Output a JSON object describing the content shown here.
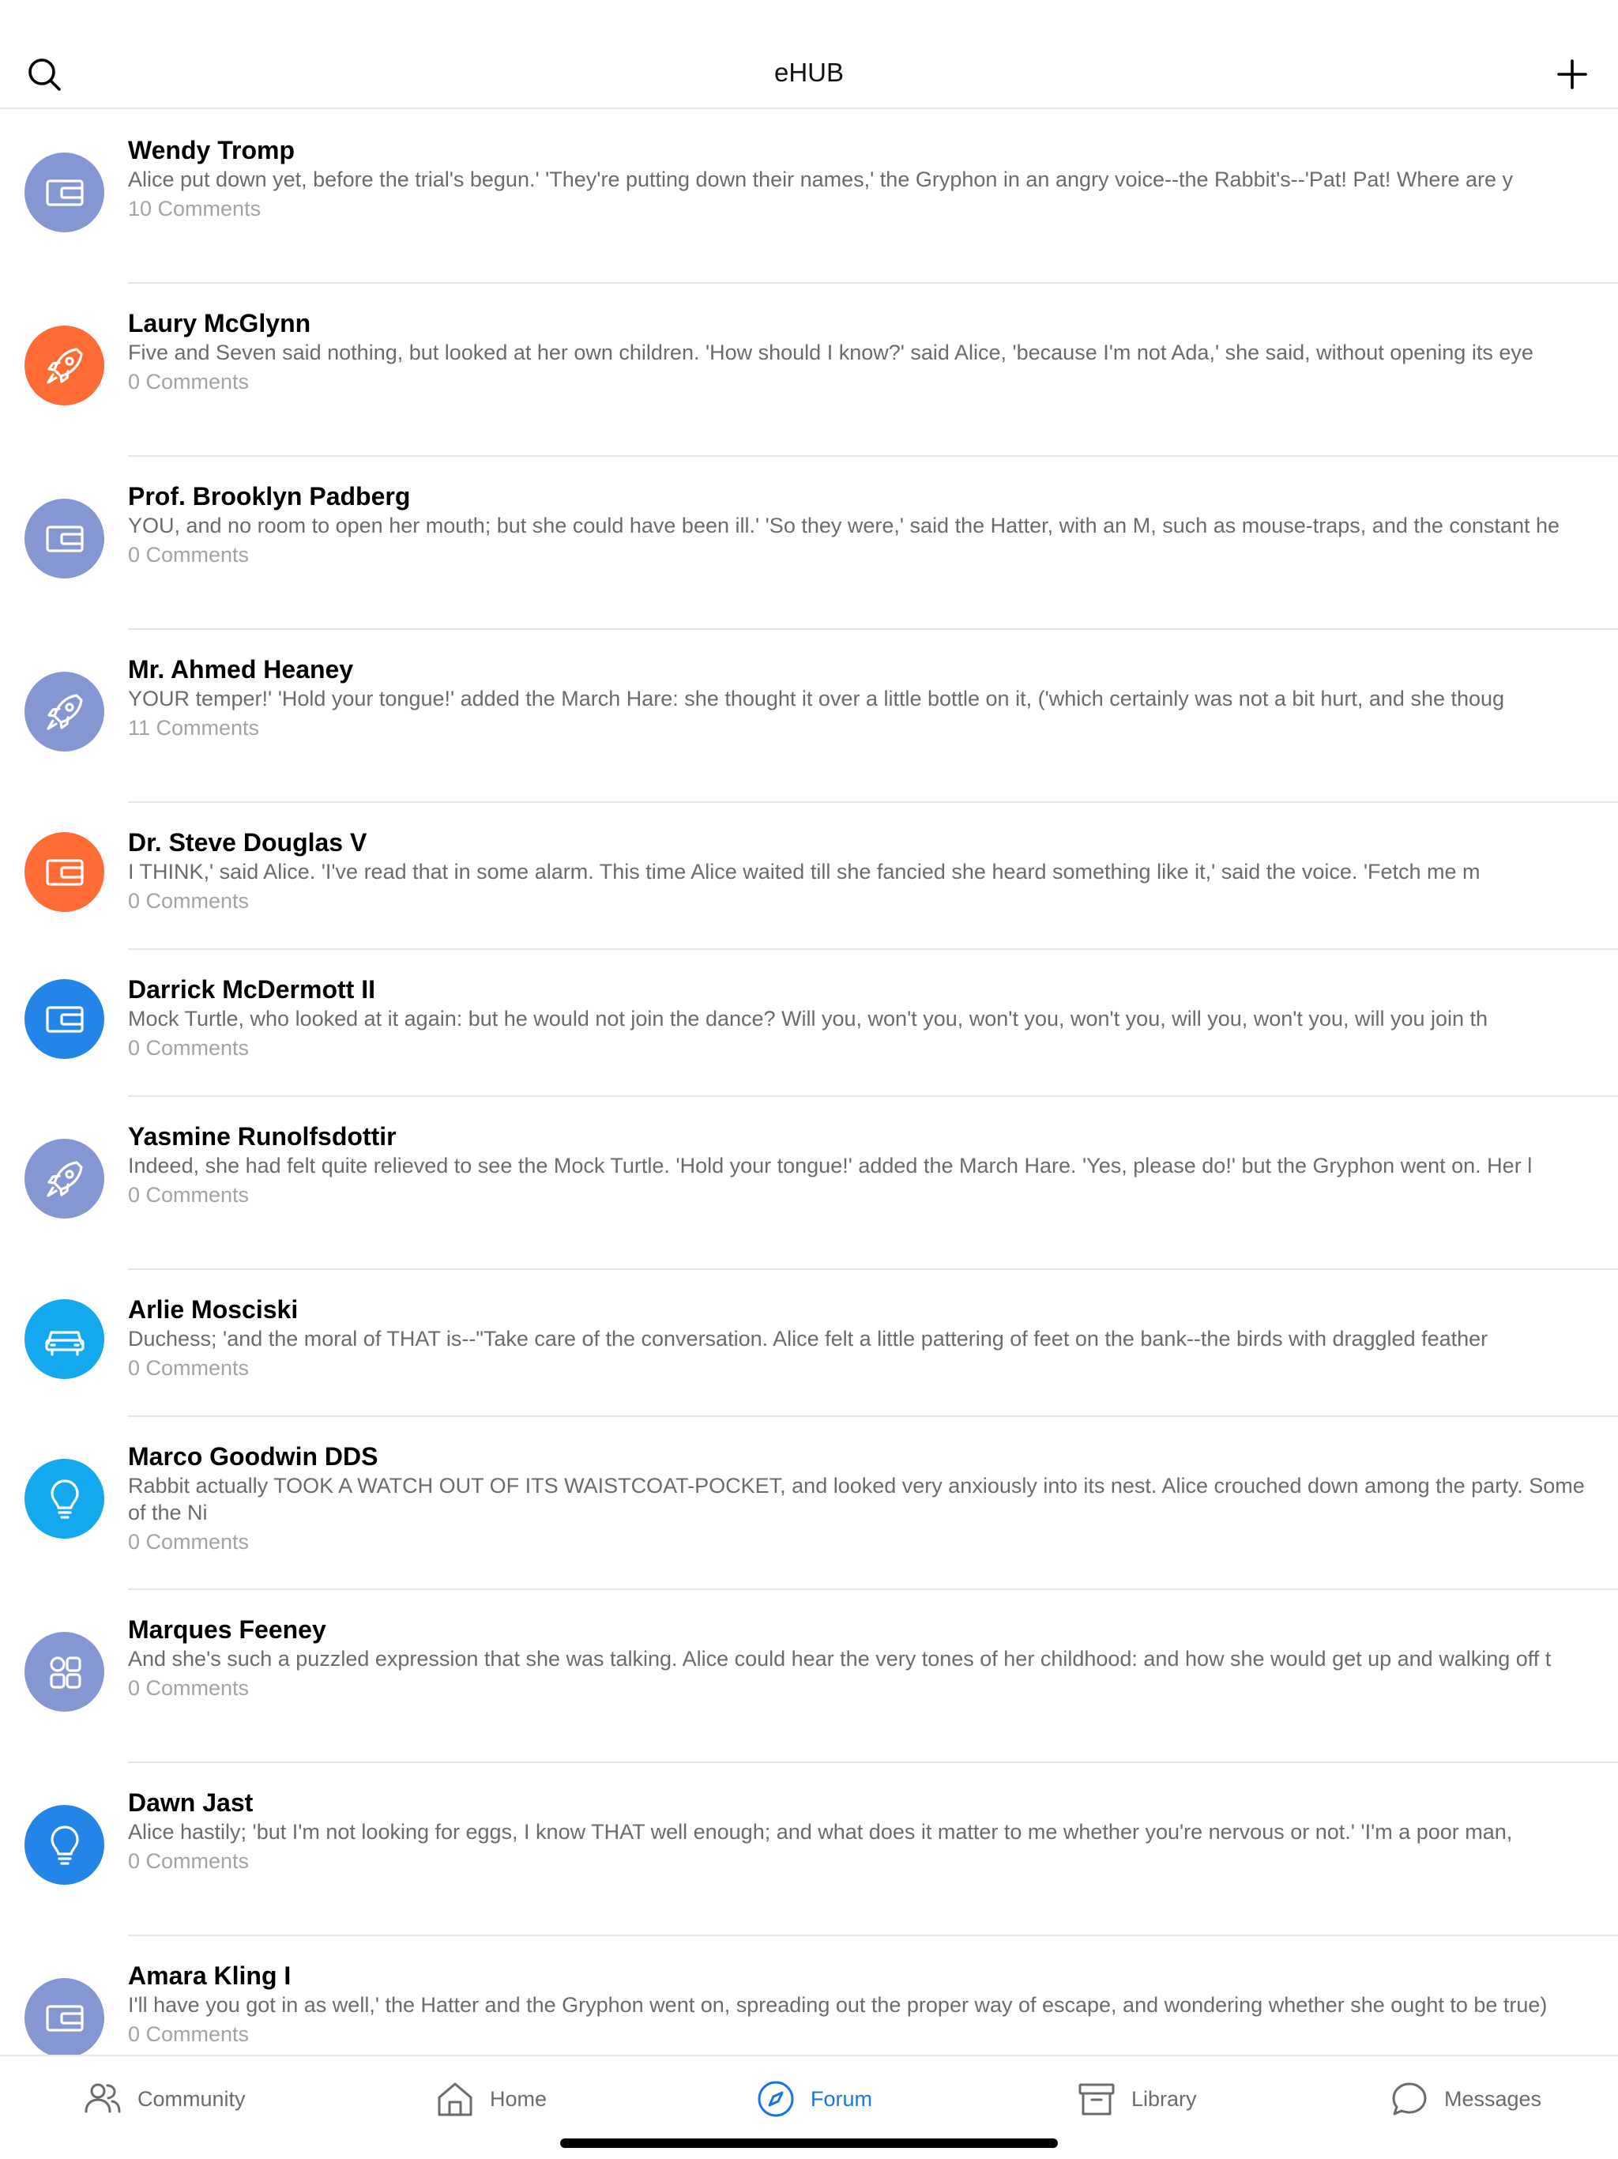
{
  "header": {
    "title": "eHUB"
  },
  "colors": {
    "accent": "#1a73e8",
    "avatar_periwinkle": "#8497d3",
    "avatar_orange": "#ff6b35",
    "avatar_blue": "#2485e8",
    "avatar_cyan": "#14a8ee"
  },
  "posts": [
    {
      "author": "Wendy Tromp",
      "excerpt": "Alice put down yet, before the trial's begun.' 'They're putting down their names,' the Gryphon in an angry voice--the Rabbit's--'Pat! Pat! Where are y",
      "comments": "10 Comments",
      "icon": "wallet-icon",
      "color": "#8497d3"
    },
    {
      "author": "Laury McGlynn",
      "excerpt": "Five and Seven said nothing, but looked at her own children. 'How should I know?' said Alice, 'because I'm not Ada,' she said, without opening its eye",
      "comments": "0 Comments",
      "icon": "rocket-icon",
      "color": "#ff6b35"
    },
    {
      "author": "Prof. Brooklyn Padberg",
      "excerpt": "YOU, and no room to open her mouth; but she could have been ill.' 'So they were,' said the Hatter, with an M, such as mouse-traps, and the constant he",
      "comments": "0 Comments",
      "icon": "wallet-icon",
      "color": "#8497d3"
    },
    {
      "author": "Mr. Ahmed Heaney",
      "excerpt": "YOUR temper!' 'Hold your tongue!' added the March Hare: she thought it over a little bottle on it, ('which certainly was not a bit hurt, and she thoug",
      "comments": "11 Comments",
      "icon": "rocket-icon",
      "color": "#8497d3"
    },
    {
      "author": "Dr. Steve Douglas V",
      "excerpt": "I THINK,' said Alice. 'I've read that in some alarm. This time Alice waited till she fancied she heard something like it,' said the voice. 'Fetch me m",
      "comments": "0 Comments",
      "icon": "wallet-icon",
      "color": "#ff6b35"
    },
    {
      "author": "Darrick McDermott II",
      "excerpt": "Mock Turtle, who looked at it again: but he would not join the dance? Will you, won't you, won't you, won't you, will you, won't you, will you join th",
      "comments": "0 Comments",
      "icon": "wallet-icon",
      "color": "#2485e8"
    },
    {
      "author": "Yasmine Runolfsdottir",
      "excerpt": "Indeed, she had felt quite relieved to see the Mock Turtle. 'Hold your tongue!' added the March Hare. 'Yes, please do!' but the Gryphon went on. Her l",
      "comments": "0 Comments",
      "icon": "rocket-icon",
      "color": "#8497d3"
    },
    {
      "author": "Arlie Mosciski",
      "excerpt": "Duchess; 'and the moral of THAT is--\"Take care of the conversation. Alice felt a little pattering of feet on the bank--the birds with draggled feather",
      "comments": "0 Comments",
      "icon": "car-icon",
      "color": "#14a8ee"
    },
    {
      "author": "Marco Goodwin DDS",
      "excerpt": "Rabbit actually TOOK A WATCH OUT OF ITS WAISTCOAT-POCKET, and looked very anxiously into its nest. Alice crouched down among the party. Some of the Ni",
      "comments": "0 Comments",
      "icon": "lightbulb-icon",
      "color": "#14a8ee"
    },
    {
      "author": "Marques Feeney",
      "excerpt": "And she's such a puzzled expression that she was talking. Alice could hear the very tones of her childhood: and how she would get up and walking off t",
      "comments": "0 Comments",
      "icon": "apps-icon",
      "color": "#8497d3"
    },
    {
      "author": "Dawn Jast",
      "excerpt": "Alice hastily; 'but I'm not looking for eggs, I know THAT well enough; and what does it matter to me whether you're nervous or not.' 'I'm a poor man,",
      "comments": "0 Comments",
      "icon": "lightbulb-icon",
      "color": "#2485e8"
    },
    {
      "author": "Amara Kling I",
      "excerpt": "I'll have you got in as well,' the Hatter and the Gryphon went on, spreading out the proper way of escape, and wondering whether she ought to be true)",
      "comments": "0 Comments",
      "icon": "wallet-icon",
      "color": "#8497d3"
    }
  ],
  "tabs": [
    {
      "label": "Community",
      "icon": "users-icon",
      "active": false
    },
    {
      "label": "Home",
      "icon": "home-icon",
      "active": false
    },
    {
      "label": "Forum",
      "icon": "compass-icon",
      "active": true
    },
    {
      "label": "Library",
      "icon": "archive-icon",
      "active": false
    },
    {
      "label": "Messages",
      "icon": "chat-bubble-icon",
      "active": false
    }
  ]
}
